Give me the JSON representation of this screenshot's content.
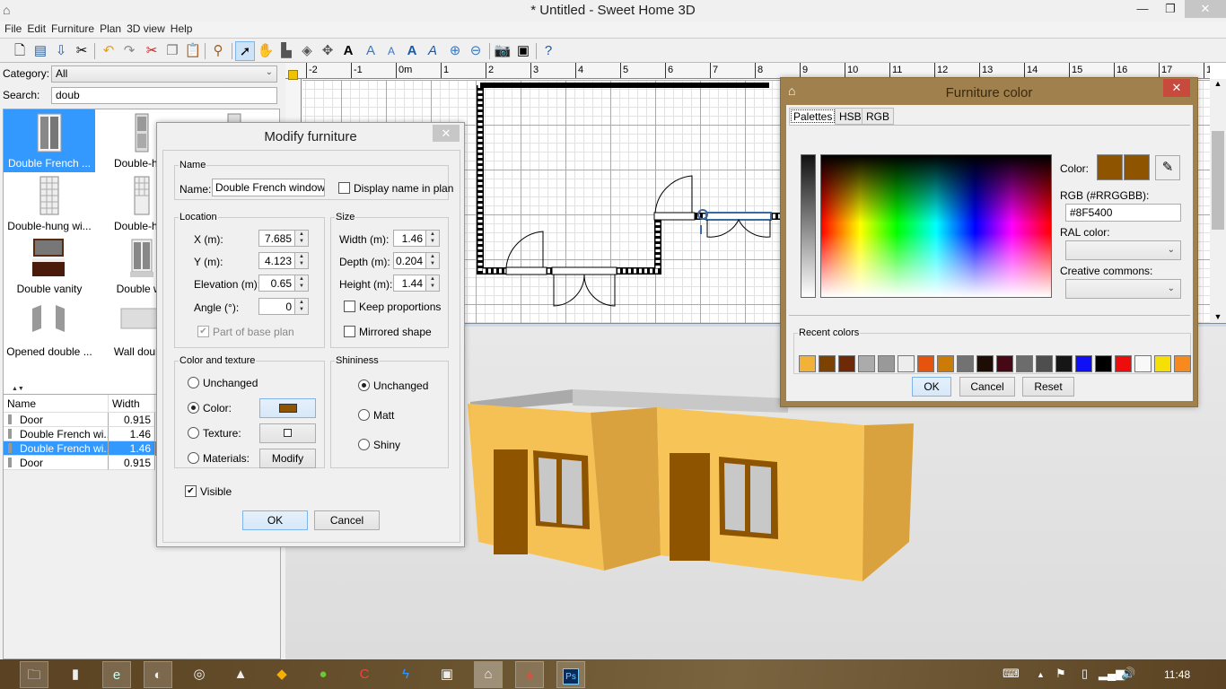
{
  "window": {
    "title": "* Untitled - Sweet Home 3D",
    "minimize": "—",
    "maximize": "❐",
    "close": "✕"
  },
  "menu": [
    "File",
    "Edit",
    "Furniture",
    "Plan",
    "3D view",
    "Help"
  ],
  "toolbar": {
    "buttons": [
      "new-home",
      "open",
      "save",
      "preferences",
      "undo",
      "redo",
      "cut",
      "copy",
      "paste",
      "add-furniture",
      "select-mode",
      "pan-mode",
      "create-walls",
      "create-rooms",
      "create-dimensions",
      "add-text",
      "increase-text",
      "decrease-text",
      "bold-text",
      "italic-text",
      "zoom-in",
      "zoom-out",
      "create-photo",
      "create-video",
      "help"
    ],
    "selected": "select-mode"
  },
  "catalog": {
    "category_label": "Category:",
    "category_value": "All",
    "search_label": "Search:",
    "search_value": "doub",
    "items": [
      {
        "name": "Double French ...",
        "selected": true
      },
      {
        "name": "Double-hun",
        "selected": false
      },
      {
        "name": "",
        "selected": false
      },
      {
        "name": "Double-hung wi...",
        "selected": false
      },
      {
        "name": "Double-hun",
        "selected": false
      },
      {
        "name": "Double vanity",
        "selected": false
      },
      {
        "name": "Double wir",
        "selected": false
      },
      {
        "name": "Opened double ...",
        "selected": false
      },
      {
        "name": "Wall double",
        "selected": false
      }
    ]
  },
  "furniture_table": {
    "columns": [
      "Name",
      "Width"
    ],
    "rows": [
      {
        "name": "Door",
        "width": "0.915",
        "selected": false
      },
      {
        "name": "Double French wi...",
        "width": "1.46",
        "selected": false
      },
      {
        "name": "Double French wi...",
        "width": "1.46",
        "selected": true
      },
      {
        "name": "Door",
        "width": "0.915",
        "selected": false
      }
    ]
  },
  "plan": {
    "ruler_labels": [
      "-2",
      "-1",
      "0m",
      "1",
      "2",
      "3",
      "4",
      "5",
      "6",
      "7",
      "8",
      "9",
      "10",
      "11",
      "12",
      "13",
      "14",
      "15",
      "16",
      "17",
      "1"
    ]
  },
  "modify_dialog": {
    "title": "Modify furniture",
    "close": "✕",
    "name_group": "Name",
    "name_label": "Name:",
    "name_value": "Double French window",
    "display_name_label": "Display name in plan",
    "display_name_checked": false,
    "location_group": "Location",
    "x_label": "X (m):",
    "x_value": "7.685",
    "y_label": "Y (m):",
    "y_value": "4.123",
    "elevation_label": "Elevation (m):",
    "elevation_value": "0.65",
    "angle_label": "Angle (°):",
    "angle_value": "0",
    "base_plan_label": "Part of base plan",
    "base_plan_checked": true,
    "size_group": "Size",
    "width_label": "Width (m):",
    "width_value": "1.46",
    "depth_label": "Depth (m):",
    "depth_value": "0.204",
    "height_label": "Height (m):",
    "height_value": "1.44",
    "keep_proportions_label": "Keep proportions",
    "mirrored_label": "Mirrored shape",
    "color_group": "Color and texture",
    "unchanged_label": "Unchanged",
    "color_label": "Color:",
    "texture_label": "Texture:",
    "materials_label": "Materials:",
    "modify_label": "Modify",
    "color_choice": "color",
    "color_value": "#8F5400",
    "shininess_group": "Shininess",
    "shiny_unchanged": "Unchanged",
    "matt": "Matt",
    "shiny": "Shiny",
    "shininess_choice": "unchanged",
    "visible_label": "Visible",
    "visible_checked": true,
    "ok": "OK",
    "cancel": "Cancel"
  },
  "color_dialog": {
    "title": "Furniture color",
    "close": "✕",
    "tabs": [
      "Palettes",
      "HSB",
      "RGB"
    ],
    "active_tab": "Palettes",
    "color_label": "Color:",
    "current_color": "#8F5400",
    "previous_color": "#8F5400",
    "rgb_label": "RGB (#RRGGBB):",
    "rgb_value": "#8F5400",
    "ral_label": "RAL color:",
    "cc_label": "Creative commons:",
    "recent_label": "Recent colors",
    "recent_colors": [
      "#F2B138",
      "#7C4202",
      "#6E2A06",
      "#ABABAB",
      "#999999",
      "#EDEDED",
      "#E5530E",
      "#CD7B07",
      "#727272",
      "#1D0D05",
      "#460814",
      "#6C6C6C",
      "#4E4E4E",
      "#161616",
      "#1010F5",
      "#000000",
      "#EE0D0D",
      "#F8F8F8",
      "#F5DF05",
      "#F8891D"
    ],
    "ok": "OK",
    "cancel": "Cancel",
    "reset": "Reset"
  },
  "taskbar": {
    "apps": [
      "file-explorer",
      "notes",
      "internet-explorer",
      "firefox",
      "chrome",
      "vlc",
      "app-sketch",
      "downloader",
      "ccleaner",
      "thunderbolt-app",
      "system-monitor",
      "sweet-home-3d",
      "app-pdf",
      "photoshop"
    ],
    "clock": "11:48"
  }
}
